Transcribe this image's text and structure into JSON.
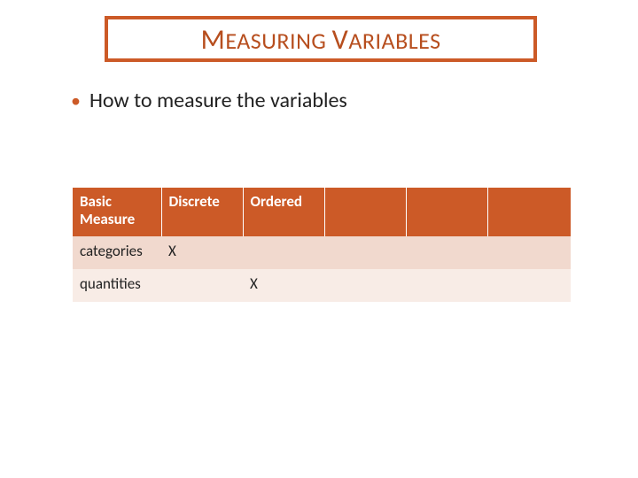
{
  "title": {
    "word1_cap": "M",
    "word1_rest": "EASURING",
    "word2_cap": "V",
    "word2_rest": "ARIABLES"
  },
  "bullet": {
    "text": "How to measure the variables"
  },
  "table": {
    "headers": [
      "Basic Measure",
      "Discrete",
      "Ordered",
      "",
      "",
      ""
    ],
    "rows": [
      {
        "label": "categories",
        "cells": [
          "X",
          "",
          "",
          "",
          ""
        ]
      },
      {
        "label": "quantities",
        "cells": [
          "",
          "X",
          "",
          "",
          ""
        ]
      }
    ]
  }
}
